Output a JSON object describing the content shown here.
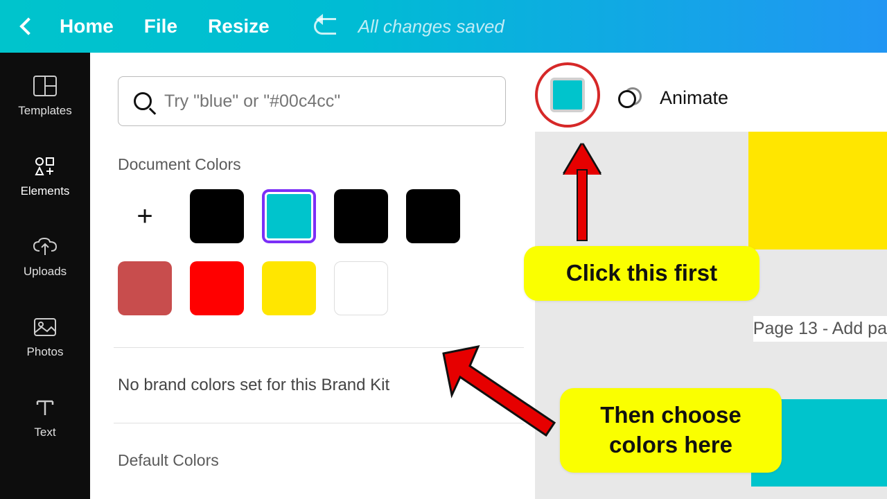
{
  "topbar": {
    "home": "Home",
    "file": "File",
    "resize": "Resize",
    "status": "All changes saved"
  },
  "sidebar": {
    "items": [
      {
        "label": "Templates"
      },
      {
        "label": "Elements"
      },
      {
        "label": "Uploads"
      },
      {
        "label": "Photos"
      },
      {
        "label": "Text"
      }
    ]
  },
  "panel": {
    "search_placeholder": "Try \"blue\" or \"#00c4cc\"",
    "doc_colors_title": "Document Colors",
    "brand_msg": "No brand colors set for this Brand Kit",
    "default_title": "Default Colors",
    "colors": {
      "teal": "#00c4cc",
      "black": "#000000",
      "redmute": "#c84d4d",
      "red": "#ff0000",
      "yellow": "#ffe600",
      "white": "#ffffff"
    }
  },
  "context": {
    "animate": "Animate",
    "color": "#00c4cc"
  },
  "canvas": {
    "page_label": "Page 13 - Add pa"
  },
  "annotations": {
    "step1": "Click this first",
    "step2": "Then choose colors here"
  }
}
